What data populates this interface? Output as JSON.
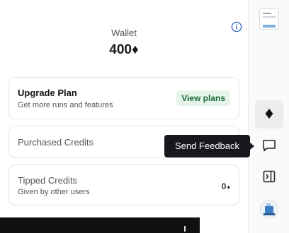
{
  "wallet": {
    "label": "Wallet",
    "amount": "400♦"
  },
  "upgrade": {
    "title": "Upgrade Plan",
    "subtitle": "Get more runs and features",
    "button": "View plans"
  },
  "purchased": {
    "title": "Purchased Credits"
  },
  "tipped": {
    "title": "Tipped Credits",
    "subtitle": "Given by other users",
    "amount": "0",
    "unit": "♦"
  },
  "tooltip": {
    "text": "Send Feedback"
  },
  "sidebar": {
    "icons": [
      "document-thumbnail",
      "diamond-icon",
      "chat-bubble-icon",
      "panel-collapse-icon",
      "avatar"
    ]
  },
  "colors": {
    "accent_green_bg": "#e6f4ea",
    "accent_green_text": "#1e6b3a",
    "info_blue": "#2b63c6",
    "tooltip_bg": "#16181d"
  }
}
